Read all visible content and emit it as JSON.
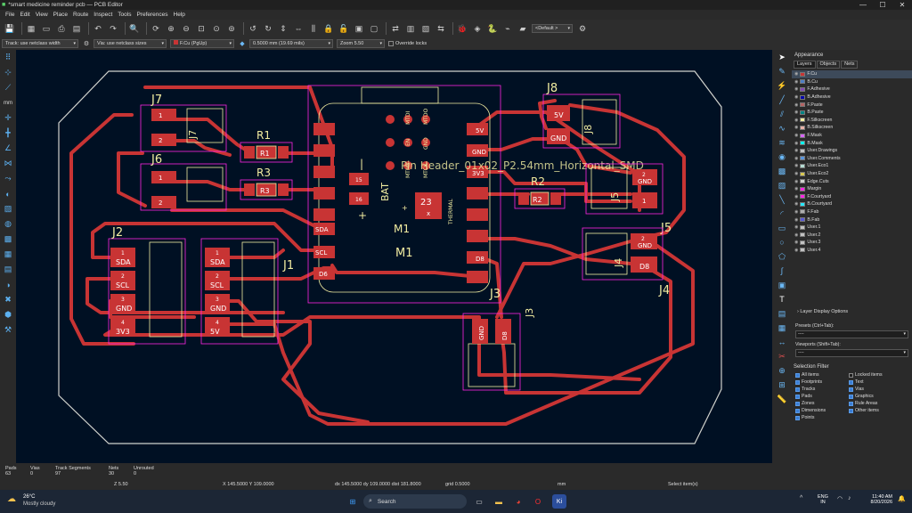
{
  "window": {
    "title": "*smart medicine reminder pcb — PCB Editor",
    "min": "—",
    "max": "☐",
    "close": "✕"
  },
  "menu": [
    "File",
    "Edit",
    "View",
    "Place",
    "Route",
    "Inspect",
    "Tools",
    "Preferences",
    "Help"
  ],
  "options": {
    "track": "Track: use netclass width",
    "via": "Via: use netclass sizes",
    "layer": "F.Cu (PgUp)",
    "grid": "0.5000 mm (19.69 mils)",
    "zoom": "Zoom 5.50",
    "override": "Override locks",
    "preset_default": "<Default >"
  },
  "board": {
    "refs": [
      "J7",
      "J6",
      "R1",
      "R3",
      "J2",
      "J1",
      "M1",
      "M1",
      "J3",
      "J8",
      "R2",
      "J5",
      "J4",
      "BAT",
      "THERMAL",
      "Pin Header_01x02_P2.54mm_Horizontal_SMD"
    ],
    "plus": "+",
    "j2_pins": [
      "SDA",
      "SCL",
      "GND",
      "3V3"
    ],
    "j1_pins": [
      "SDA",
      "SCL",
      "GND",
      "5V"
    ],
    "j8_pins": [
      "5V",
      "GND"
    ],
    "j5_pins": [
      "GND"
    ],
    "j4_pins": [
      "GND",
      "D8"
    ],
    "j3_pins": [
      "GND",
      "D8"
    ],
    "m1_left": [
      "",
      "",
      "",
      "",
      "",
      "SDA",
      "SCL",
      "D6"
    ],
    "m1_right": [
      "5V",
      "GND",
      "3V3",
      "",
      "",
      "",
      "D8",
      ""
    ],
    "m1_top": [
      "MTDI",
      "MTDO",
      "EN",
      "GND",
      "MTMS",
      "MTCK"
    ],
    "m1_center": "23",
    "m1_center_sub": "x",
    "small_pads": [
      "15",
      "16"
    ]
  },
  "appearance": {
    "title": "Appearance",
    "tabs": [
      "Layers",
      "Objects",
      "Nets"
    ],
    "layers": [
      {
        "name": "F.Cu",
        "color": "#c83434"
      },
      {
        "name": "B.Cu",
        "color": "#4d7fc4"
      },
      {
        "name": "F.Adhesive",
        "color": "#844ab0"
      },
      {
        "name": "B.Adhesive",
        "color": "#0000a8"
      },
      {
        "name": "F.Paste",
        "color": "#b46464"
      },
      {
        "name": "B.Paste",
        "color": "#008484"
      },
      {
        "name": "F.Silkscreen",
        "color": "#f2eda1"
      },
      {
        "name": "B.Silkscreen",
        "color": "#e8b2a7"
      },
      {
        "name": "F.Mask",
        "color": "#d864ff"
      },
      {
        "name": "B.Mask",
        "color": "#02ffee"
      },
      {
        "name": "User.Drawings",
        "color": "#c2c2c2"
      },
      {
        "name": "User.Comments",
        "color": "#5994dc"
      },
      {
        "name": "User.Eco1",
        "color": "#b4dbd2"
      },
      {
        "name": "User.Eco2",
        "color": "#d8c852"
      },
      {
        "name": "Edge.Cuts",
        "color": "#d0d2cd"
      },
      {
        "name": "Margin",
        "color": "#ff26e2"
      },
      {
        "name": "F.Courtyard",
        "color": "#ff26e2"
      },
      {
        "name": "B.Courtyard",
        "color": "#26e9ff"
      },
      {
        "name": "F.Fab",
        "color": "#afafaf"
      },
      {
        "name": "B.Fab",
        "color": "#5858d4"
      },
      {
        "name": "User.1",
        "color": "#c2c2c2"
      },
      {
        "name": "User.2",
        "color": "#c2c2c2"
      },
      {
        "name": "User.3",
        "color": "#c2c2c2"
      },
      {
        "name": "User.4",
        "color": "#c2c2c2"
      }
    ],
    "layer_display_options": "Layer Display Options",
    "presets_label": "Presets (Ctrl+Tab):",
    "presets_value": "----",
    "viewports_label": "Viewports (Shift+Tab):",
    "viewports_value": "----"
  },
  "selection_filter": {
    "title": "Selection Filter",
    "items": [
      {
        "label": "All items",
        "checked": true
      },
      {
        "label": "Locked items",
        "checked": false
      },
      {
        "label": "Footprints",
        "checked": true
      },
      {
        "label": "Text",
        "checked": true
      },
      {
        "label": "Tracks",
        "checked": true
      },
      {
        "label": "Vias",
        "checked": true
      },
      {
        "label": "Pads",
        "checked": true
      },
      {
        "label": "Graphics",
        "checked": true
      },
      {
        "label": "Zones",
        "checked": true
      },
      {
        "label": "Rule Areas",
        "checked": true
      },
      {
        "label": "Dimensions",
        "checked": true
      },
      {
        "label": "Other items",
        "checked": true
      },
      {
        "label": "Points",
        "checked": true
      }
    ]
  },
  "status": {
    "pads_label": "Pads",
    "pads": "63",
    "vias_label": "Vias",
    "vias": "0",
    "tracks_label": "Track Segments",
    "tracks": "97",
    "nets_label": "Nets",
    "nets": "30",
    "unrouted_label": "Unrouted",
    "unrouted": "0",
    "z": "Z 5.50",
    "xy": "X 145.5000  Y 109.0000",
    "dxdy": "dx 145.5000  dy 109.0000  dist 181.8000",
    "grid": "grid 0.5000",
    "units": "mm",
    "message": "Select item(s)"
  },
  "taskbar": {
    "temp": "26°C",
    "weather": "Mostly cloudy",
    "search": "Search",
    "lang1": "ENG",
    "lang2": "IN",
    "time": "11:40 AM",
    "date": "8/20/2026"
  }
}
